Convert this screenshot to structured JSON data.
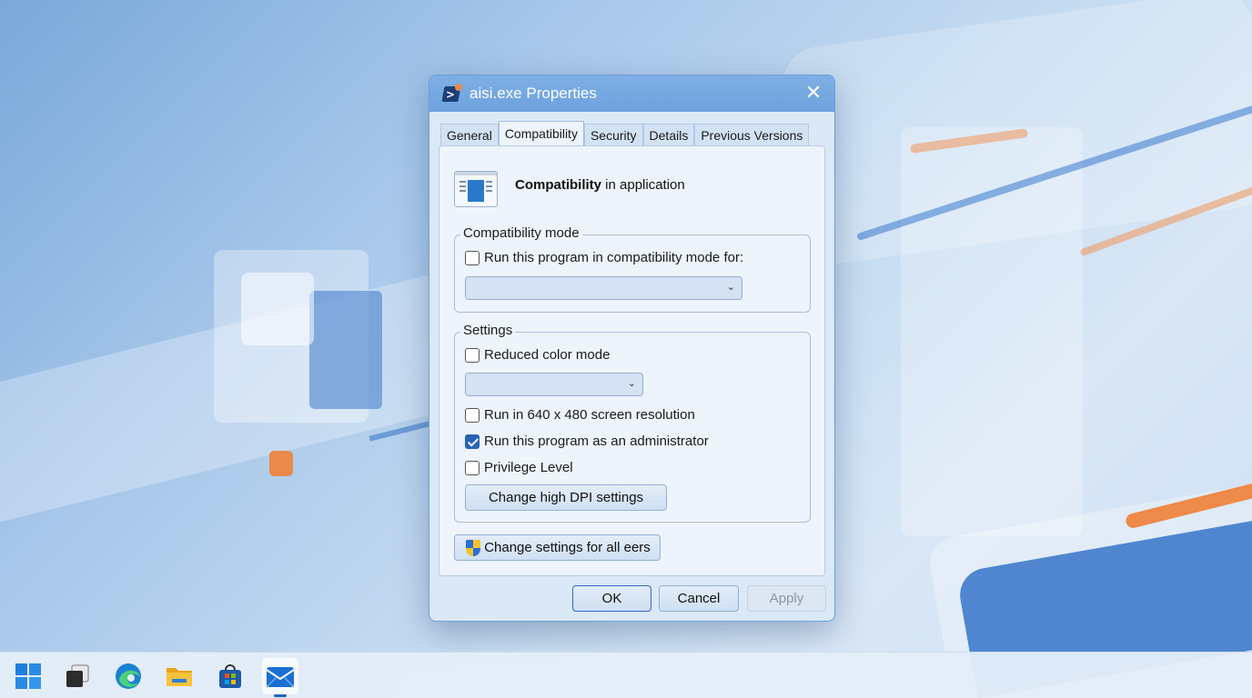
{
  "dialog": {
    "title": "aisi.exe Properties",
    "close_glyph": "✕",
    "tabs": [
      {
        "label": "General",
        "active": false
      },
      {
        "label": "Compatibility",
        "active": true
      },
      {
        "label": "Security",
        "active": false
      },
      {
        "label": "Details",
        "active": false
      },
      {
        "label": "Previous Versions",
        "active": false
      }
    ],
    "header": {
      "bold": "Compatibility",
      "rest": " in application"
    },
    "compat_mode": {
      "label": "Compatibility mode",
      "checkbox_label": "Run this program in compatibility mode for:",
      "checked": false,
      "dropdown_value": ""
    },
    "settings": {
      "label": "Settings",
      "reduced_color": {
        "label": "Reduced color mode",
        "checked": false
      },
      "color_dropdown_value": "",
      "res_640": {
        "label": "Run in 640 x 480 screen resolution",
        "checked": false
      },
      "admin": {
        "label": "Run this program as an administrator",
        "checked": true
      },
      "privilege": {
        "label": "Privilege Level",
        "checked": false
      },
      "dpi_button": "Change high DPI settings"
    },
    "all_users_button": "Change settings for all eers",
    "buttons": {
      "ok": "OK",
      "cancel": "Cancel",
      "apply": "Apply"
    }
  },
  "taskbar": {
    "items": [
      "windows-start-icon",
      "task-view-icon",
      "edge-browser-icon",
      "file-explorer-icon",
      "microsoft-store-icon",
      "mail-icon"
    ],
    "active": "mail-icon"
  },
  "colors": {
    "accent": "#2763b8",
    "titlebar": "#72a6e0",
    "dialog_bg": "#dbe8f6"
  }
}
